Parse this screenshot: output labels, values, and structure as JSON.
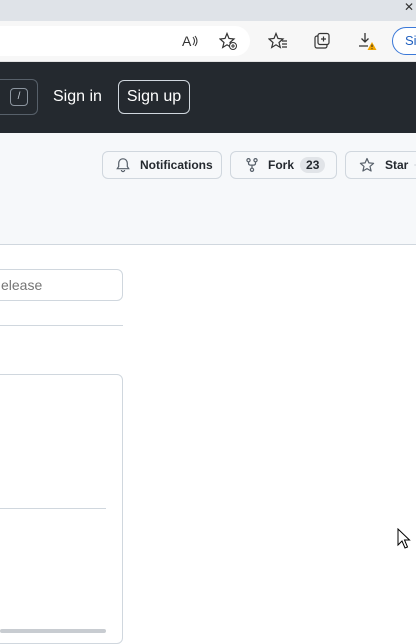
{
  "browser": {
    "window_close_glyph": "✕",
    "profile_label": "Si",
    "icons": [
      "read-aloud-icon",
      "add-favorite-icon",
      "favorites-icon",
      "collections-icon",
      "downloads-warning-icon"
    ]
  },
  "header": {
    "search_shortcut": "/",
    "sign_in": "Sign in",
    "sign_up": "Sign up"
  },
  "repo_actions": {
    "notifications_label": "Notifications",
    "fork_label": "Fork",
    "fork_count": "23",
    "star_label": "Star"
  },
  "content": {
    "search_placeholder": "elease"
  },
  "colors": {
    "header_bg": "#24292f",
    "repo_header_bg": "#f6f8fa",
    "border": "#d0d7de"
  }
}
